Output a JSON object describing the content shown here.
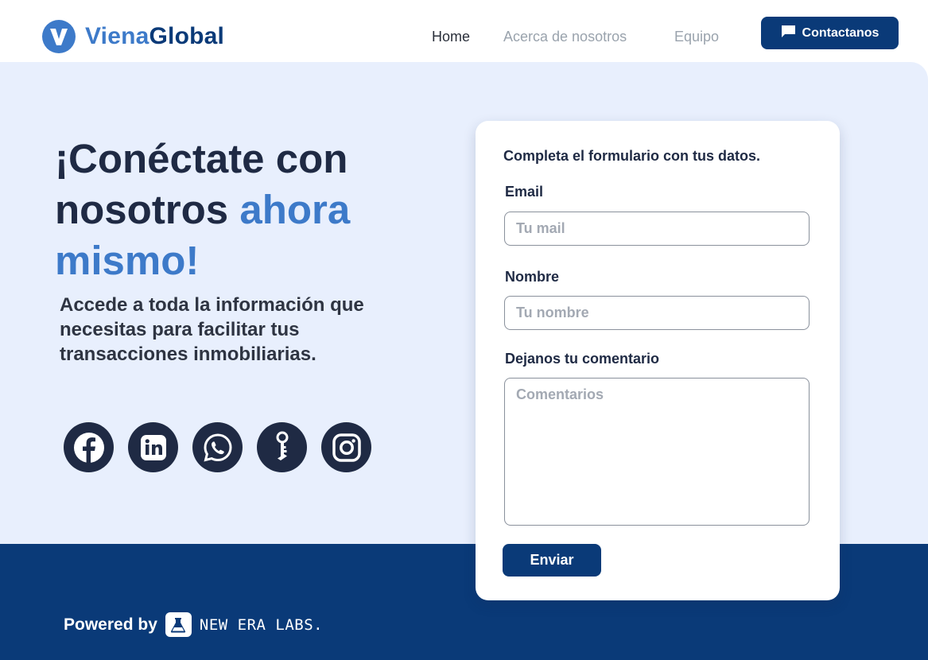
{
  "header": {
    "logo_part1": "Viena",
    "logo_part2": "Global",
    "nav": {
      "home": "Home",
      "about": "Acerca de nosotros",
      "team": "Equipo"
    },
    "contact_button": "Contactanos"
  },
  "hero": {
    "headline_part1": "¡Conéctate con nosotros ",
    "headline_highlight": "ahora mismo!",
    "subtext": "Accede a toda la información que necesitas para facilitar tus transacciones inmobiliarias.",
    "socials": [
      "facebook-icon",
      "linkedin-icon",
      "whatsapp-icon",
      "keyhole-icon",
      "instagram-icon"
    ]
  },
  "form": {
    "title": "Completa el formulario con tus datos.",
    "email_label": "Email",
    "email_placeholder": "Tu mail",
    "name_label": "Nombre",
    "name_placeholder": "Tu nombre",
    "comment_label": "Dejanos tu comentario",
    "comment_placeholder": "Comentarios",
    "submit_label": "Enviar"
  },
  "footer": {
    "powered_by": "Powered by",
    "lab_name": "NEW ERA LABS."
  },
  "colors": {
    "primary_dark": "#0a3a78",
    "accent_blue": "#3d7ac9",
    "hero_bg": "#e8effd",
    "text_dark": "#1f2a44"
  }
}
